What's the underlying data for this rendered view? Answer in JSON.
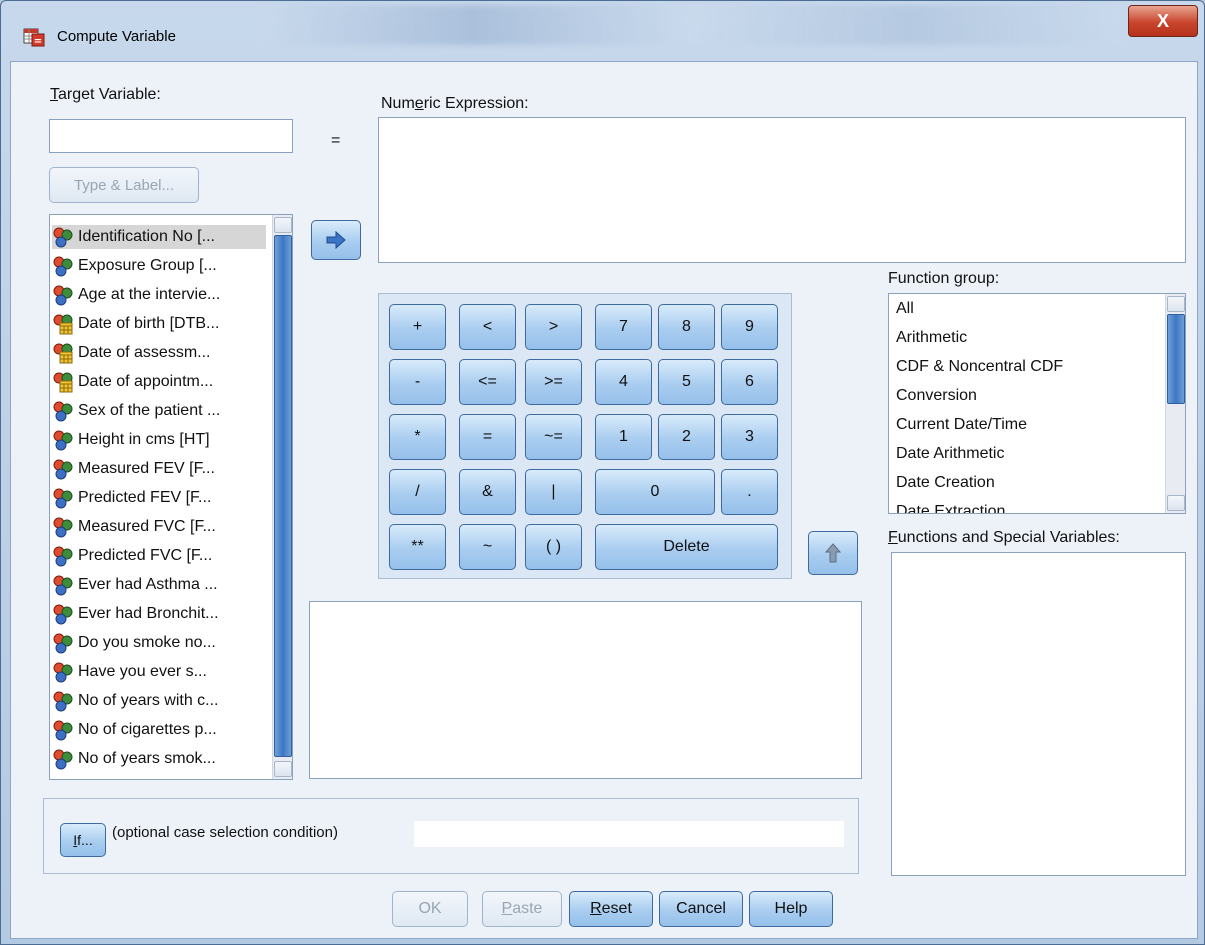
{
  "window": {
    "title": "Compute Variable",
    "close_label": "X"
  },
  "target": {
    "label_pre": "",
    "label_mnemonic": "T",
    "label_post": "arget Variable:",
    "value": "",
    "type_label_button": "Type & Label..."
  },
  "equals_sign": "=",
  "numeric_expression": {
    "label_pre": "Num",
    "label_mnemonic": "e",
    "label_post": "ric Expression:",
    "value": ""
  },
  "variables": [
    {
      "label": "Identification No [...",
      "icon": "nominal-variable-icon",
      "selected": true
    },
    {
      "label": "Exposure Group [...",
      "icon": "nominal-variable-icon"
    },
    {
      "label": "Age at the intervie...",
      "icon": "nominal-variable-icon"
    },
    {
      "label": "Date of birth [DTB...",
      "icon": "date-variable-icon"
    },
    {
      "label": "Date of assessm...",
      "icon": "date-variable-icon"
    },
    {
      "label": "Date of appointm...",
      "icon": "date-variable-icon"
    },
    {
      "label": "Sex of the patient ...",
      "icon": "nominal-variable-icon"
    },
    {
      "label": "Height in cms [HT]",
      "icon": "nominal-variable-icon"
    },
    {
      "label": "Measured FEV [F...",
      "icon": "nominal-variable-icon"
    },
    {
      "label": "Predicted FEV [F...",
      "icon": "nominal-variable-icon"
    },
    {
      "label": "Measured FVC [F...",
      "icon": "nominal-variable-icon"
    },
    {
      "label": "Predicted FVC [F...",
      "icon": "nominal-variable-icon"
    },
    {
      "label": "Ever had Asthma ...",
      "icon": "nominal-variable-icon"
    },
    {
      "label": "Ever had Bronchit...",
      "icon": "nominal-variable-icon"
    },
    {
      "label": "Do you smoke no...",
      "icon": "nominal-variable-icon"
    },
    {
      "label": "Have you ever s...",
      "icon": "nominal-variable-icon"
    },
    {
      "label": "No of years with c...",
      "icon": "nominal-variable-icon"
    },
    {
      "label": "No of cigarettes p...",
      "icon": "nominal-variable-icon"
    },
    {
      "label": "No of years smok...",
      "icon": "nominal-variable-icon"
    }
  ],
  "keypad": {
    "plus": "+",
    "lt": "<",
    "gt": ">",
    "k7": "7",
    "k8": "8",
    "k9": "9",
    "minus": "-",
    "le": "<=",
    "ge": ">=",
    "k4": "4",
    "k5": "5",
    "k6": "6",
    "mult": "*",
    "eq": "=",
    "ne": "~=",
    "k1": "1",
    "k2": "2",
    "k3": "3",
    "div": "/",
    "and": "&",
    "or": "|",
    "k0": "0",
    "dot": ".",
    "pow": "**",
    "not": "~",
    "paren": "( )",
    "delete": "Delete"
  },
  "function_group": {
    "label_pre": "Function ",
    "label_mnemonic": "g",
    "label_post": "roup:",
    "items": [
      "All",
      "Arithmetic",
      "CDF & Noncentral CDF",
      "Conversion",
      "Current Date/Time",
      "Date Arithmetic",
      "Date Creation",
      "Date Extraction"
    ]
  },
  "functions_special": {
    "label_pre": "",
    "label_mnemonic": "F",
    "label_post": "unctions and Special Variables:"
  },
  "if_condition": {
    "button_mnemonic": "I",
    "button_post": "f...",
    "text": "(optional case selection condition)"
  },
  "footer": {
    "ok": "OK",
    "paste_mnemonic": "P",
    "paste_post": "aste",
    "reset_mnemonic": "R",
    "reset_post": "eset",
    "cancel": "Cancel",
    "help": "Help"
  },
  "colors": {
    "button_blue": "#a9cdf0",
    "title_close_red": "#c8452c",
    "selection_gray": "#d6d6d6"
  }
}
